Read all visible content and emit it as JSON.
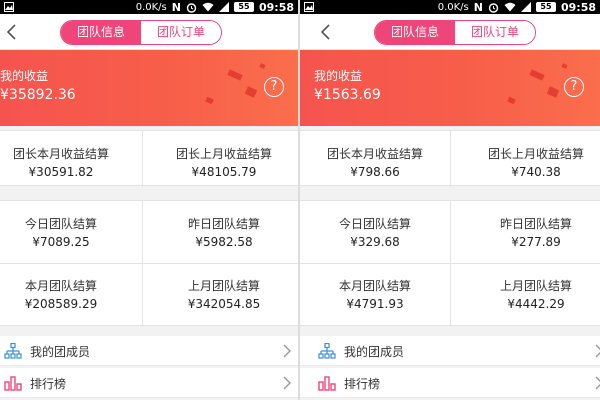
{
  "colors": {
    "accent": "#f0457a",
    "banner": "#f75e4a",
    "team_icon": "#3a8fd9",
    "rank_icon": "#f0457a"
  },
  "screens": [
    {
      "status": {
        "speed": "0.0K/s",
        "n_badge": "N",
        "battery": "55",
        "time": "09:58"
      },
      "nav": {
        "tab_active": "团队信息",
        "tab_idle": "团队订单"
      },
      "banner": {
        "label": "我的收益",
        "amount": "¥35892.36",
        "help": "?"
      },
      "leader": [
        {
          "title": "团长本月收益结算",
          "value": "¥30591.82"
        },
        {
          "title": "团长上月收益结算",
          "value": "¥48105.79"
        }
      ],
      "team": [
        {
          "title": "今日团队结算",
          "value": "¥7089.25"
        },
        {
          "title": "昨日团队结算",
          "value": "¥5982.58"
        },
        {
          "title": "本月团队结算",
          "value": "¥208589.29"
        },
        {
          "title": "上月团队结算",
          "value": "¥342054.85"
        }
      ],
      "menu": [
        {
          "label": "我的团成员",
          "icon": "team-tree-icon"
        },
        {
          "label": "排行榜",
          "icon": "ranking-icon"
        }
      ]
    },
    {
      "status": {
        "speed": "0.0K/s",
        "n_badge": "N",
        "battery": "55",
        "time": "09:58"
      },
      "nav": {
        "tab_active": "团队信息",
        "tab_idle": "团队订单"
      },
      "banner": {
        "label": "我的收益",
        "amount": "¥1563.69",
        "help": "?"
      },
      "leader": [
        {
          "title": "团长本月收益结算",
          "value": "¥798.66"
        },
        {
          "title": "团长上月收益结算",
          "value": "¥740.38"
        }
      ],
      "team": [
        {
          "title": "今日团队结算",
          "value": "¥329.68"
        },
        {
          "title": "昨日团队结算",
          "value": "¥277.89"
        },
        {
          "title": "本月团队结算",
          "value": "¥4791.93"
        },
        {
          "title": "上月团队结算",
          "value": "¥4442.29"
        }
      ],
      "menu": [
        {
          "label": "我的团成员",
          "icon": "team-tree-icon"
        },
        {
          "label": "排行榜",
          "icon": "ranking-icon"
        }
      ]
    }
  ]
}
